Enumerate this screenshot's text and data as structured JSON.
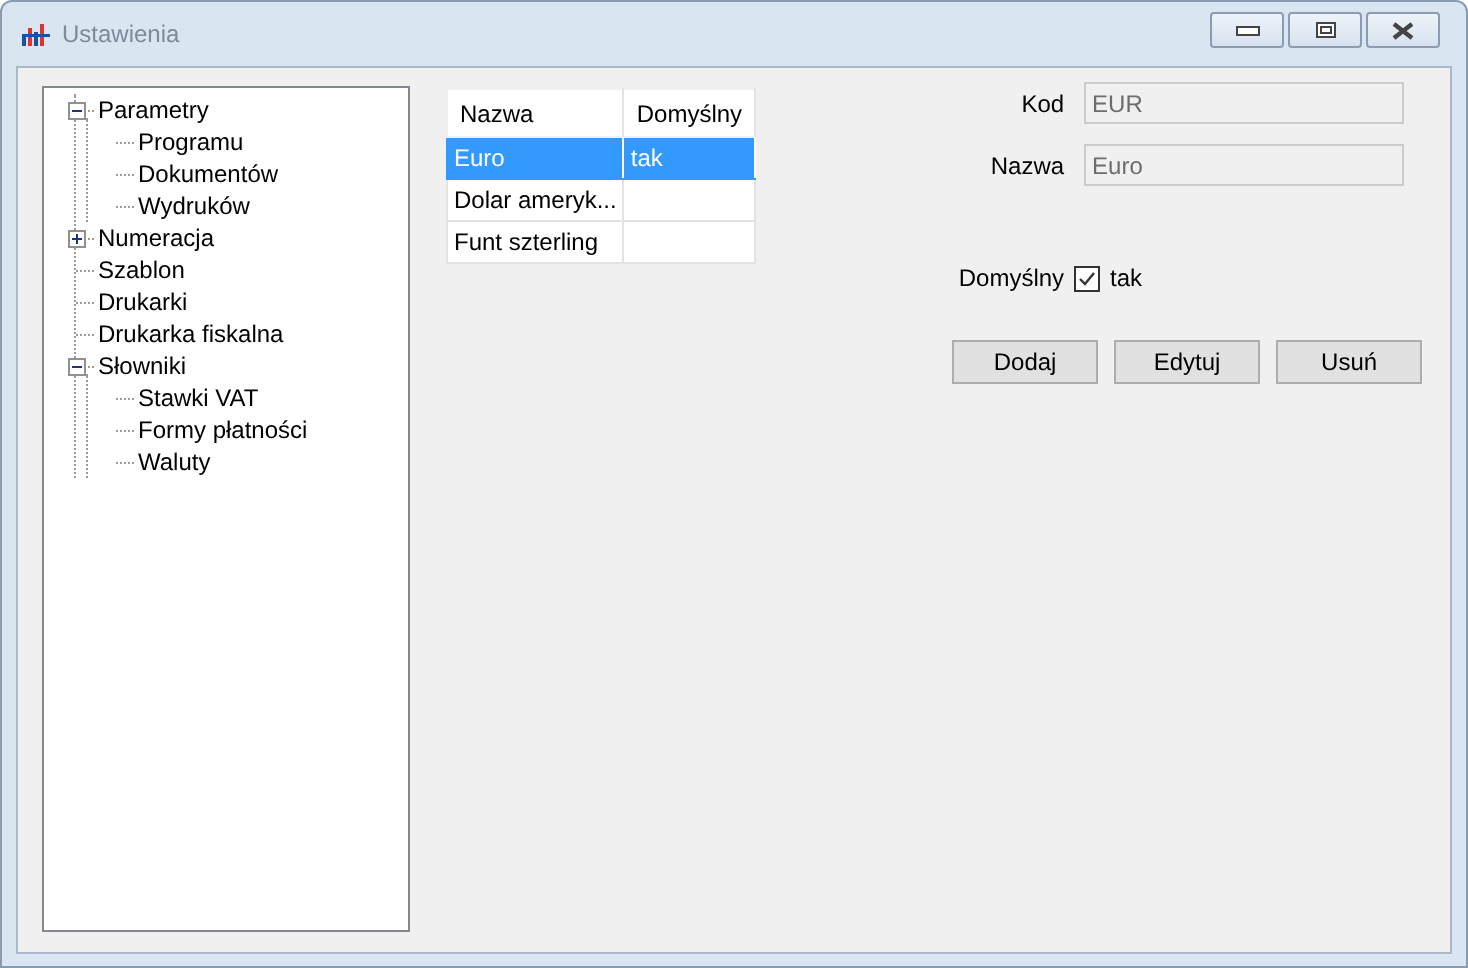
{
  "window": {
    "title": "Ustawienia"
  },
  "tree": [
    {
      "label": "Parametry",
      "expanded": true,
      "children": [
        {
          "label": "Programu"
        },
        {
          "label": "Dokumentów"
        },
        {
          "label": "Wydruków"
        }
      ]
    },
    {
      "label": "Numeracja",
      "expanded": false
    },
    {
      "label": "Szablon"
    },
    {
      "label": "Drukarki"
    },
    {
      "label": "Drukarka fiskalna"
    },
    {
      "label": "Słowniki",
      "expanded": true,
      "children": [
        {
          "label": "Stawki VAT"
        },
        {
          "label": "Formy płatności"
        },
        {
          "label": "Waluty"
        }
      ]
    }
  ],
  "table": {
    "columns": [
      "Nazwa",
      "Domyślny"
    ],
    "rows": [
      {
        "cells": [
          "Euro",
          "tak"
        ],
        "selected": true
      },
      {
        "cells": [
          "Dolar ameryk...",
          ""
        ],
        "selected": false
      },
      {
        "cells": [
          "Funt szterling",
          ""
        ],
        "selected": false
      }
    ]
  },
  "form": {
    "fields": [
      {
        "label": "Kod",
        "value": "EUR",
        "disabled": true
      },
      {
        "label": "Nazwa",
        "value": "Euro",
        "disabled": true
      }
    ],
    "default": {
      "label": "Domyślny",
      "text": "tak",
      "checked": true
    }
  },
  "buttons": [
    "Dodaj",
    "Edytuj",
    "Usuń"
  ]
}
